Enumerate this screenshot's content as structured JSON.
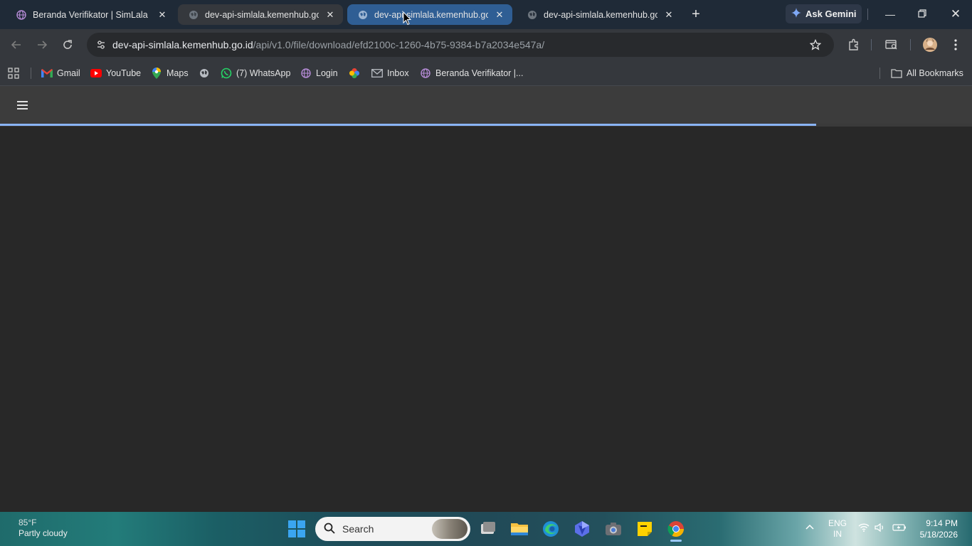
{
  "tabs": [
    {
      "title": "Beranda Verifikator | SimLala",
      "favicon": "simlala-globe-icon"
    },
    {
      "title": "dev-api-simlala.kemenhub.go.id",
      "favicon": "globe-icon"
    },
    {
      "title": "dev-api-simlala.kemenhub.go.id",
      "favicon": "globe-icon"
    },
    {
      "title": "dev-api-simlala.kemenhub.go.id",
      "favicon": "globe-icon"
    }
  ],
  "ask_gemini": "Ask Gemini",
  "omnibox": {
    "host": "dev-api-simlala.kemenhub.go.id",
    "path": "/api/v1.0/file/download/efd2100c-1260-4b75-9384-b7a2034e547a/"
  },
  "bookmarks": [
    {
      "label": "Gmail",
      "icon": "gmail-icon"
    },
    {
      "label": "YouTube",
      "icon": "youtube-icon"
    },
    {
      "label": "Maps",
      "icon": "maps-icon"
    },
    {
      "label": "",
      "icon": "globe-icon"
    },
    {
      "label": "(7) WhatsApp",
      "icon": "whatsapp-icon"
    },
    {
      "label": "Login",
      "icon": "simlala-globe-icon"
    },
    {
      "label": "",
      "icon": "photos-icon"
    },
    {
      "label": "Inbox",
      "icon": "mail-icon"
    },
    {
      "label": "Beranda Verifikator |...",
      "icon": "simlala-globe-icon"
    }
  ],
  "all_bookmarks": "All Bookmarks",
  "page": {
    "loading_progress": 0.84
  },
  "taskbar": {
    "weather_temp": "85°F",
    "weather_desc": "Partly cloudy",
    "search_placeholder": "Search",
    "lang_top": "ENG",
    "lang_bottom": "IN",
    "time": "9:14 PM",
    "date": "5/18/2026"
  },
  "colors": {
    "tabstrip": "#1f2a37",
    "active_tab": "#2f5e94",
    "toolbar": "#35383d",
    "page_bg": "#282828",
    "page_header": "#3c3c3c",
    "progress": "#8ab4f8"
  }
}
